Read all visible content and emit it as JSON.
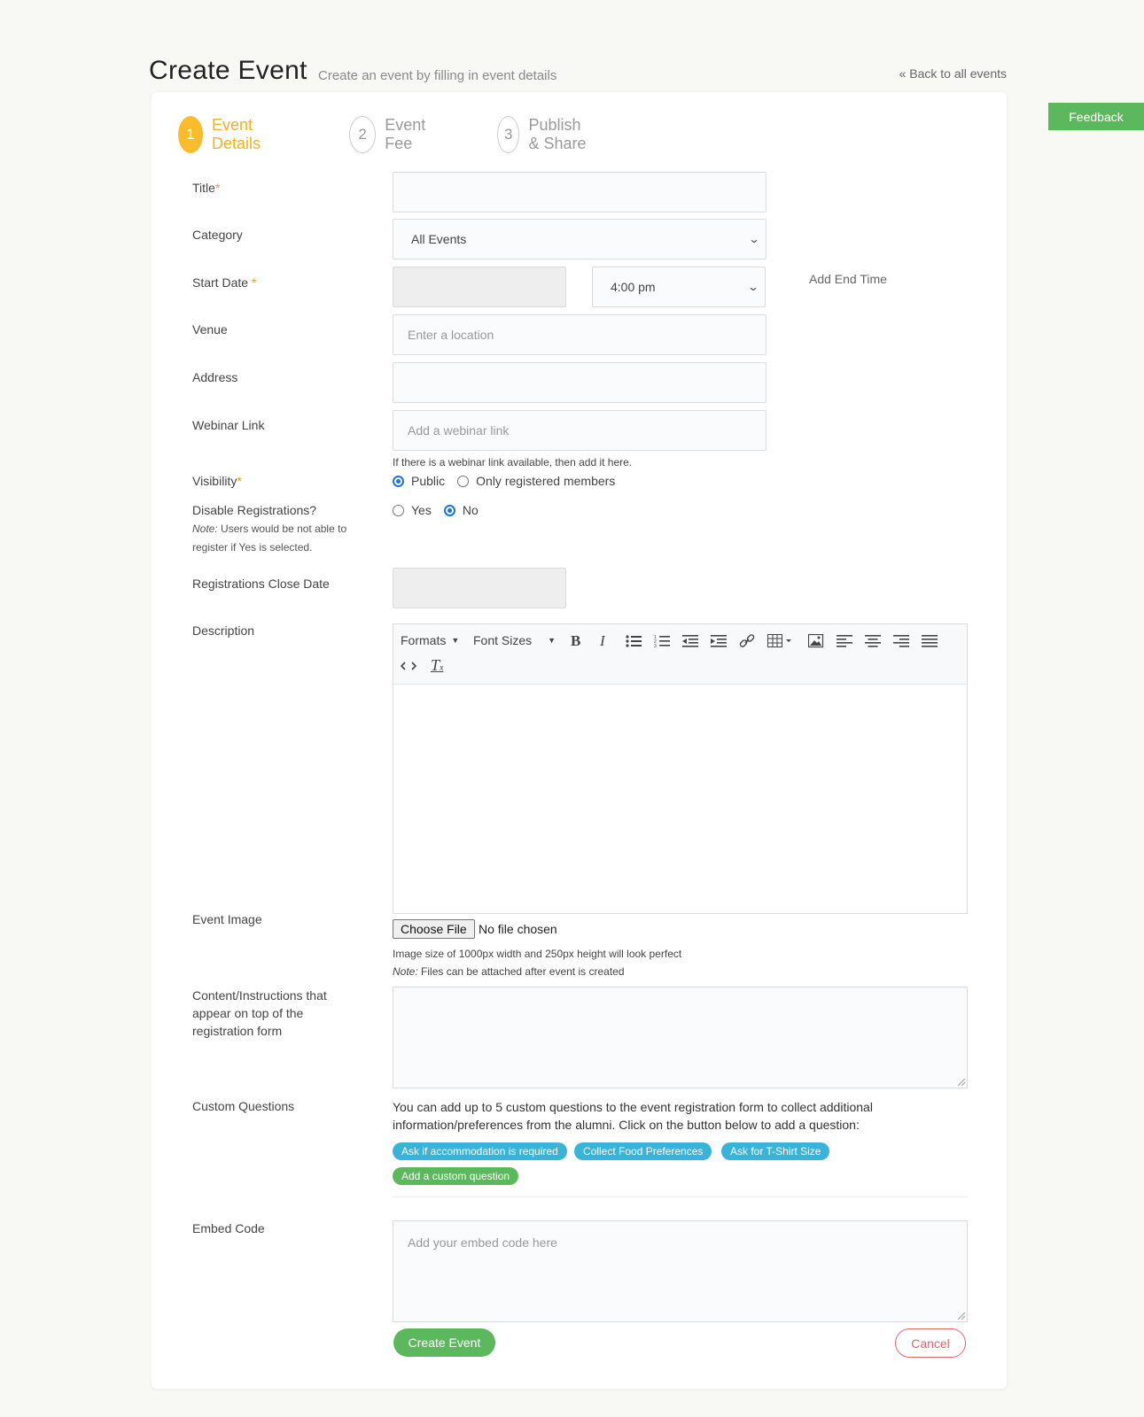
{
  "header": {
    "title": "Create Event",
    "subtitle": "Create an event by filling in event details",
    "back_link": "« Back to all events"
  },
  "feedback_label": "Feedback",
  "steps": [
    {
      "num": "1",
      "label": "Event Details",
      "active": true
    },
    {
      "num": "2",
      "label": "Event Fee",
      "active": false
    },
    {
      "num": "3",
      "label": "Publish & Share",
      "active": false
    }
  ],
  "form": {
    "title_label": "Title",
    "title_value": "",
    "category_label": "Category",
    "category_value": "All Events",
    "start_date_label": "Start Date",
    "start_date_value": "",
    "start_time_value": "4:00 pm",
    "add_end_time": "Add End Time",
    "venue_label": "Venue",
    "venue_placeholder": "Enter a location",
    "address_label": "Address",
    "address_value": "",
    "webinar_label": "Webinar Link",
    "webinar_placeholder": "Add a webinar link",
    "webinar_help": "If there is a webinar link available, then add it here.",
    "visibility_label": "Visibility",
    "visibility_options": [
      {
        "label": "Public",
        "selected": true
      },
      {
        "label": "Only registered members",
        "selected": false
      }
    ],
    "disable_reg_label": "Disable Registrations?",
    "disable_reg_note_prefix": "Note:",
    "disable_reg_note": "Users would be not able to register if Yes is selected.",
    "disable_reg_options": [
      {
        "label": "Yes",
        "selected": false
      },
      {
        "label": "No",
        "selected": true
      }
    ],
    "reg_close_label": "Registrations Close Date",
    "reg_close_value": "",
    "description_label": "Description",
    "toolbar": {
      "formats": "Formats",
      "font_sizes": "Font Sizes",
      "icons": [
        "bold-icon",
        "italic-icon",
        "bullet-list-icon",
        "numbered-list-icon",
        "outdent-icon",
        "indent-icon",
        "link-icon",
        "table-icon",
        "image-icon",
        "align-left-icon",
        "align-center-icon",
        "align-right-icon",
        "justify-icon",
        "source-code-icon",
        "clear-formatting-icon"
      ]
    },
    "event_image_label": "Event Image",
    "choose_file": "Choose File",
    "no_file": "No file chosen",
    "image_help": "Image size of 1000px width and 250px height will look perfect",
    "image_note_prefix": "Note:",
    "image_note": "Files can be attached after event is created",
    "instructions_label": "Content/Instructions that appear on top of the registration form",
    "custom_questions_label": "Custom Questions",
    "custom_questions_text": "You can add up to 5 custom questions to the event registration form to collect additional information/preferences from the alumni. Click on the button below to add a question:",
    "chips": [
      "Ask if accommodation is required",
      "Collect Food Preferences",
      "Ask for T-Shirt Size",
      "Add a custom question"
    ],
    "embed_label": "Embed Code",
    "embed_placeholder": "Add your embed code here",
    "create_button": "Create Event",
    "cancel_button": "Cancel"
  },
  "colors": {
    "accent": "#fbbc2c",
    "success": "#5cb85c",
    "info": "#39b3d7",
    "danger": "#e0656f",
    "radio": "#1a73e8"
  }
}
